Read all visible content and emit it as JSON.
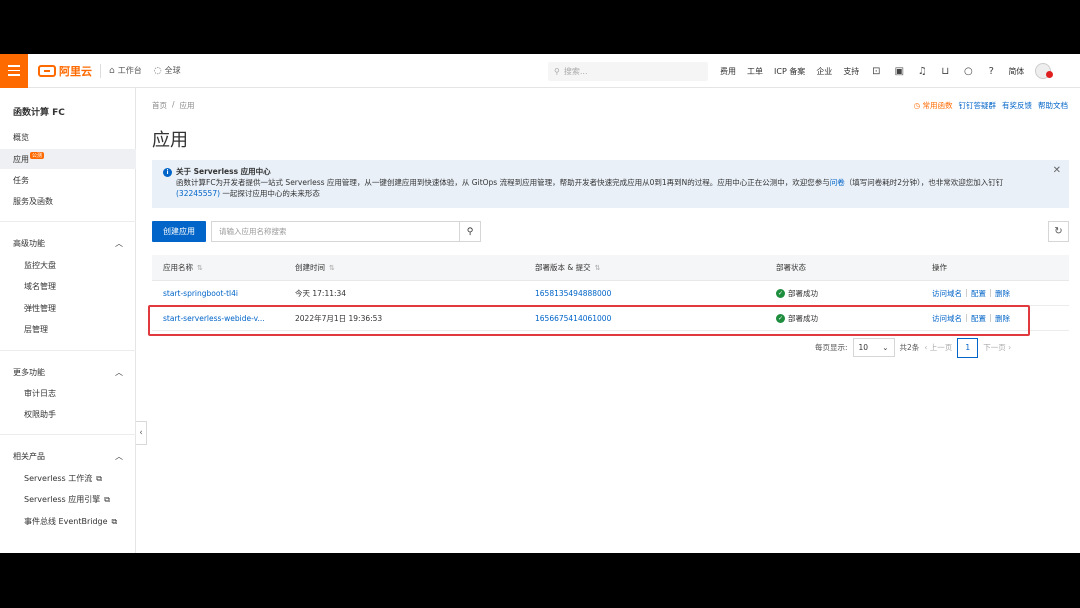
{
  "topbar": {
    "logo_text": "阿里云",
    "workbench": "工作台",
    "region": "全球",
    "search_placeholder": "搜索...",
    "links": [
      "费用",
      "工单",
      "ICP 备案",
      "企业",
      "支持"
    ],
    "lang": "简体"
  },
  "sidebar": {
    "title": "函数计算 FC",
    "items": [
      {
        "label": "概览"
      },
      {
        "label": "应用",
        "badge": "公测"
      },
      {
        "label": "任务"
      },
      {
        "label": "服务及函数"
      }
    ],
    "sections": [
      {
        "title": "高级功能",
        "items": [
          "监控大盘",
          "域名管理",
          "弹性管理",
          "层管理"
        ]
      },
      {
        "title": "更多功能",
        "items": [
          "审计日志",
          "权限助手"
        ]
      },
      {
        "title": "相关产品",
        "items": [
          "Serverless 工作流",
          "Serverless 应用引擎",
          "事件总线 EventBridge"
        ]
      }
    ]
  },
  "main": {
    "breadcrumb": [
      "首页",
      "应用"
    ],
    "help_links": {
      "orange": "常用函数",
      "links": [
        "钉钉答疑群",
        "有奖反馈",
        "帮助文档"
      ]
    },
    "title": "应用",
    "notice": {
      "title": "关于 Serverless 应用中心",
      "body": "函数计算FC为开发者提供一站式 Serverless 应用管理，从一键创建应用到快速体验，从 GitOps 流程到应用管理，帮助开发者快速完成应用从0到1再到N的过程。应用中心正在公测中，欢迎您参与",
      "link1": "问卷",
      "body2": "（填写问卷耗时2分钟），也非常欢迎您加入钉钉",
      "link2": "(32245557)",
      "body3": "一起探讨应用中心的未来形态"
    },
    "create_button": "创建应用",
    "search_placeholder": "请输入应用名称搜索",
    "table": {
      "headers": [
        "应用名称",
        "创建时间",
        "部署版本 & 提交",
        "部署状态",
        "操作"
      ],
      "rows": [
        {
          "name": "start-springboot-tl4i",
          "created": "今天 17:11:34",
          "version": "1658135494888000",
          "status": "部署成功",
          "ops": [
            "访问域名",
            "配置",
            "删除"
          ]
        },
        {
          "name": "start-serverless-webide-v...",
          "created": "2022年7月1日 19:36:53",
          "version": "1656675414061000",
          "status": "部署成功",
          "ops": [
            "访问域名",
            "配置",
            "删除"
          ]
        }
      ]
    },
    "pager": {
      "page_size_label": "每页显示:",
      "page_size": "10",
      "total": "共2条",
      "prev": "上一页",
      "current": "1",
      "next": "下一页"
    }
  },
  "colors": {
    "brand": "#ff6a00",
    "primary": "#0064c8",
    "success": "#1e8e3e",
    "highlight": "#e0393e"
  }
}
